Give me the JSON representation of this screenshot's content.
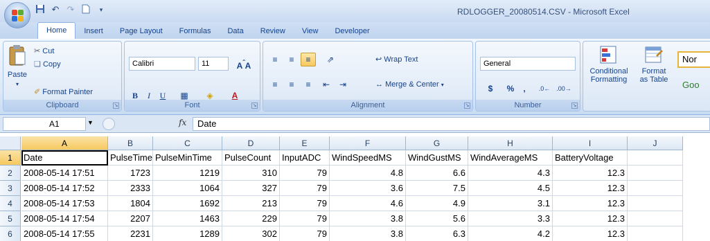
{
  "window": {
    "title": "RDLOGGER_20080514.CSV - Microsoft Excel"
  },
  "quick_access": {
    "save_icon": "save-icon",
    "undo_icon": "undo-icon",
    "redo_icon": "redo-icon",
    "new_icon": "new-doc-icon"
  },
  "tabs": [
    "Home",
    "Insert",
    "Page Layout",
    "Formulas",
    "Data",
    "Review",
    "View",
    "Developer"
  ],
  "ribbon": {
    "clipboard": {
      "label": "Clipboard",
      "paste": "Paste",
      "cut": "Cut",
      "copy": "Copy",
      "format_painter": "Format Painter"
    },
    "font": {
      "label": "Font",
      "family": "Calibri",
      "size": "11",
      "bold": "B",
      "italic": "I",
      "underline": "U"
    },
    "alignment": {
      "label": "Alignment",
      "wrap_text": "Wrap Text",
      "merge_center": "Merge & Center"
    },
    "number": {
      "label": "Number",
      "format": "General",
      "currency": "$",
      "percent": "%",
      "comma": ","
    },
    "styles": {
      "conditional_line1": "Conditional",
      "conditional_line2": "Formatting",
      "format_line1": "Format",
      "format_line2": "as Table",
      "normal_style": "Nor",
      "good_style": "Goo"
    }
  },
  "formula_bar": {
    "name_box": "A1",
    "fx": "fx",
    "content": "Date"
  },
  "sheet": {
    "columns": [
      "A",
      "B",
      "C",
      "D",
      "E",
      "F",
      "G",
      "H",
      "I",
      "J"
    ],
    "rows": [
      [
        "Date",
        "PulseTime",
        "PulseMinTime",
        "PulseCount",
        "InputADC",
        "WindSpeedMS",
        "WindGustMS",
        "WindAverageMS",
        "BatteryVoltage",
        ""
      ],
      [
        "2008-05-14 17:51",
        "1723",
        "1219",
        "310",
        "79",
        "4.8",
        "6.6",
        "4.3",
        "12.3",
        ""
      ],
      [
        "2008-05-14 17:52",
        "2333",
        "1064",
        "327",
        "79",
        "3.6",
        "7.5",
        "4.5",
        "12.3",
        ""
      ],
      [
        "2008-05-14 17:53",
        "1804",
        "1692",
        "213",
        "79",
        "4.6",
        "4.9",
        "3.1",
        "12.3",
        ""
      ],
      [
        "2008-05-14 17:54",
        "2207",
        "1463",
        "229",
        "79",
        "3.8",
        "5.6",
        "3.3",
        "12.3",
        ""
      ],
      [
        "2008-05-14 17:55",
        "2231",
        "1289",
        "302",
        "79",
        "3.8",
        "6.3",
        "4.2",
        "12.3",
        ""
      ]
    ],
    "row_numbers": [
      "1",
      "2",
      "3",
      "4",
      "5",
      "6"
    ]
  }
}
